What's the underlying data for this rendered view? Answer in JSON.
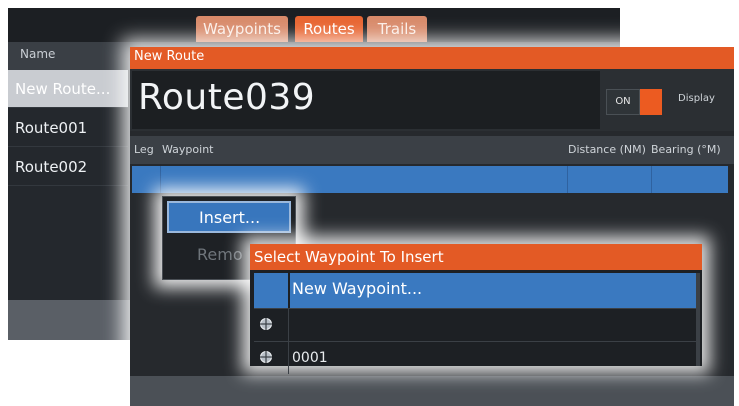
{
  "background_window": {
    "tabs": [
      {
        "label": "Waypoints",
        "active": false
      },
      {
        "label": "Routes",
        "active": true
      },
      {
        "label": "Trails",
        "active": false
      }
    ],
    "list_header": "Name",
    "items": [
      {
        "label": "New Route...",
        "selected": true
      },
      {
        "label": "Route001",
        "selected": false
      },
      {
        "label": "Route002",
        "selected": false
      }
    ]
  },
  "new_route_dialog": {
    "title": "New Route",
    "route_name": "Route039",
    "toggle_state": "ON",
    "display_label": "Display",
    "columns": {
      "leg": "Leg",
      "waypoint": "Waypoint",
      "distance": "Distance (NM)",
      "bearing": "Bearing (°M)"
    }
  },
  "context_menu": {
    "insert_label": "Insert...",
    "remove_label": "Remo"
  },
  "select_waypoint_dialog": {
    "title": "Select Waypoint To Insert",
    "new_waypoint_label": "New Waypoint...",
    "rows": [
      {
        "icon": "waypoint-icon",
        "label": ""
      },
      {
        "icon": "waypoint-icon",
        "label": "0001"
      }
    ]
  },
  "colors": {
    "accent_orange": "#e35a25",
    "selection_blue": "#3a79c0",
    "panel_dark": "#26292d"
  }
}
